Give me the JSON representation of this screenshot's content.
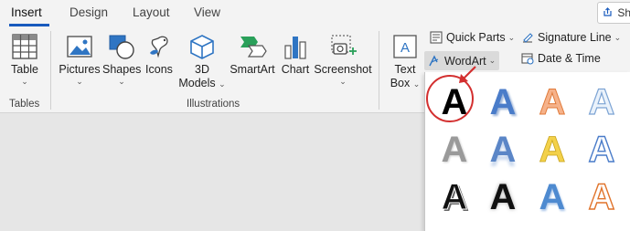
{
  "tabs": [
    {
      "label": "Insert",
      "active": true
    },
    {
      "label": "Design",
      "active": false
    },
    {
      "label": "Layout",
      "active": false
    },
    {
      "label": "View",
      "active": false
    }
  ],
  "share": {
    "label": "Sh",
    "icon": "share-icon"
  },
  "ribbon": {
    "tables": {
      "button": "Table",
      "group": "Tables"
    },
    "illustrations": {
      "group": "Illustrations",
      "pictures": "Pictures",
      "shapes": "Shapes",
      "icons": "Icons",
      "models_line1": "3D",
      "models_line2": "Models",
      "smartart": "SmartArt",
      "chart": "Chart",
      "screenshot": "Screenshot"
    },
    "text": {
      "textbox_line1": "Text",
      "textbox_line2": "Box",
      "quick_parts": "Quick Parts",
      "wordart": "WordArt",
      "signature_line": "Signature Line",
      "date_time": "Date & Time"
    }
  },
  "wordart_gallery": {
    "glyph": "A",
    "styles": [
      "black-fill",
      "blue-shadow",
      "orange-gradient",
      "light-blue-outline",
      "gray-gradient",
      "blue-reflection",
      "gold-fill",
      "blue-outline",
      "black-white-outline",
      "black-glow",
      "blue-bevel",
      "orange-outline"
    ],
    "selected_index": 0
  },
  "colors": {
    "accent": "#185abd",
    "highlight_circle": "#d32f2f"
  }
}
